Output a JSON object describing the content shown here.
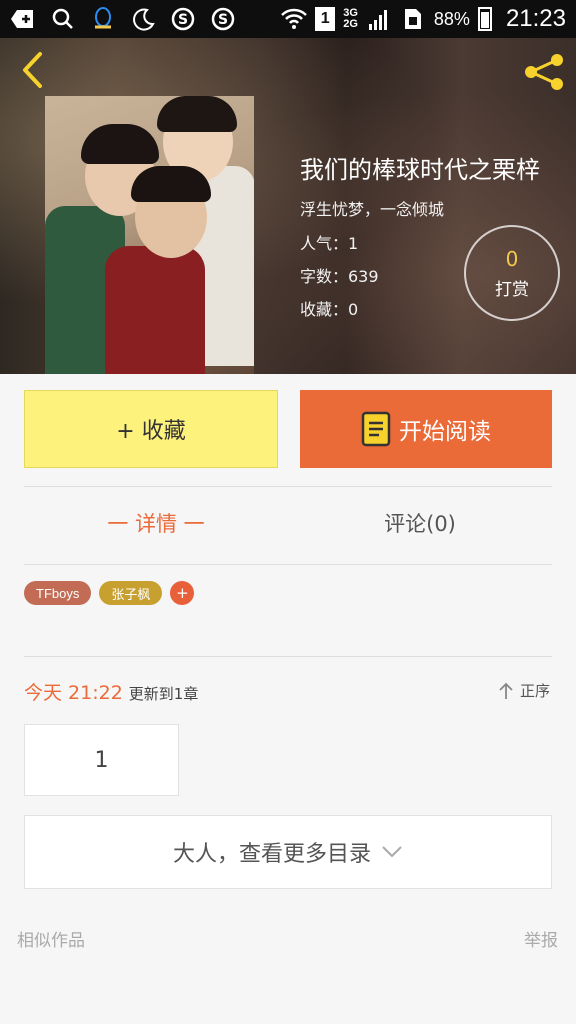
{
  "status_bar": {
    "sim": "1",
    "net_top": "3G",
    "net_bottom": "2G",
    "battery": "88%",
    "time": "21:23"
  },
  "book": {
    "title": "我们的棒球时代之栗梓",
    "author": "浮生忧梦，一念倾城",
    "popularity": "人气：1",
    "word_count": "字数：639",
    "favorites": "收藏：0",
    "tip_count": "0",
    "tip_label": "打赏"
  },
  "actions": {
    "favorite": "+ 收藏",
    "start_reading": "开始阅读"
  },
  "tabs": {
    "detail": "一 详情 一",
    "comments": "评论(0)"
  },
  "tags": [
    "TFboys",
    "张子枫"
  ],
  "tag_add": "+",
  "update": {
    "time": "今天 21:22",
    "info": "更新到1章",
    "sort": "正序"
  },
  "chapters": [
    "1"
  ],
  "more_catalog": "大人，查看更多目录",
  "footer": {
    "similar": "相似作品",
    "report": "举报"
  },
  "colors": {
    "accent": "#ea6a38",
    "favorite_button": "#fdf27b",
    "tip_gold": "#f2c94c"
  }
}
